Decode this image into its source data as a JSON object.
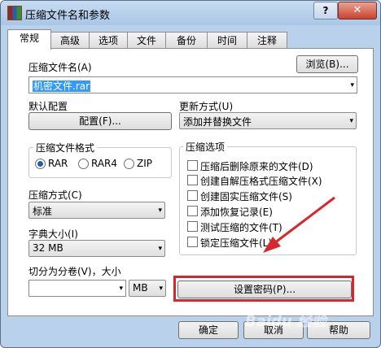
{
  "title": "压缩文件名和参数",
  "help_label": "?",
  "close_label": "✕",
  "tabs": [
    "常规",
    "高级",
    "选项",
    "文件",
    "备份",
    "时间",
    "注释"
  ],
  "archive_name": {
    "label": "压缩文件名(A)",
    "value": "机密文件.rar",
    "browse_label": "浏览(B)..."
  },
  "profiles": {
    "label": "默认配置",
    "button_label": "配置(F)..."
  },
  "update_mode": {
    "label": "更新方式(U)",
    "value": "添加并替换文件"
  },
  "archive_format": {
    "label": "压缩文件格式",
    "options": [
      "RAR",
      "RAR4",
      "ZIP"
    ],
    "selected": "RAR"
  },
  "compression_method": {
    "label": "压缩方式(C)",
    "value": "标准"
  },
  "dictionary_size": {
    "label": "字典大小(I)",
    "value": "32 MB"
  },
  "split_volumes": {
    "label": "切分为分卷(V)，大小",
    "value": "",
    "unit": "MB"
  },
  "archive_options": {
    "label": "压缩选项",
    "items": [
      "压缩后删除原来的文件(D)",
      "创建自解压格式压缩文件(X)",
      "创建固实压缩文件(S)",
      "添加恢复记录(E)",
      "测试压缩的文件(T)",
      "锁定压缩文件(L)"
    ]
  },
  "set_password_label": "设置密码(P)...",
  "ok_label": "确定",
  "cancel_label": "取消",
  "help_button_label": "帮助",
  "watermark": "Baidu 经验",
  "colors": {
    "highlight": "#d9262c",
    "selection": "#3399ff"
  },
  "icons": {
    "caret": "▾"
  }
}
